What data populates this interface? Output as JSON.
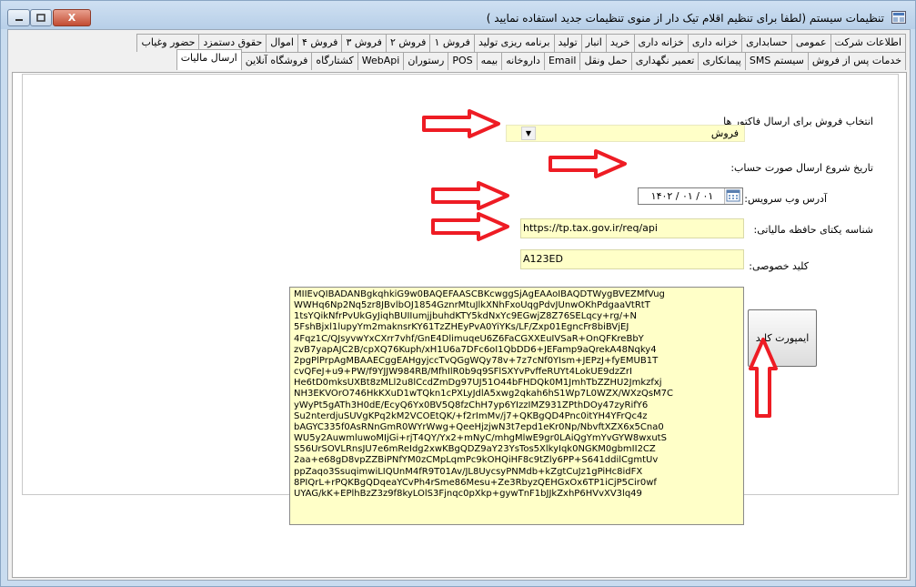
{
  "window": {
    "title": "تنظیمات سیستم (لطفا برای تنظیم اقلام تیک دار از منوی تنظیمات جدید استفاده نمایید )",
    "close_label": "X"
  },
  "tabs_row1": [
    "اطلاعات شرکت",
    "عمومی",
    "حسابداری",
    "خزانه داری",
    "خزانه داری",
    "خرید",
    "انبار",
    "تولید",
    "برنامه ریزی تولید",
    "فروش ۱",
    "فروش ۲",
    "فروش ۳",
    "فروش ۴",
    "اموال",
    "حقوق دستمزد",
    "حضور وغیاب"
  ],
  "tabs_row2": [
    "خدمات پس از فروش",
    "سیستم SMS",
    "پیمانکاری",
    "تعمیر نگهداری",
    "حمل ونقل",
    "Email",
    "داروخانه",
    "بیمه",
    "POS",
    "رستوران",
    "WebApi",
    "کشتارگاه",
    "فروشگاه آنلاین",
    "ارسال مالیات"
  ],
  "active_tab": "ارسال مالیات",
  "form": {
    "invoice_label": "انتخاب فروش برای ارسال فاکتور ها",
    "invoice_value": "فروش",
    "start_date_label": "تاریخ شروع ارسال صورت حساب:",
    "start_date_value": "۱۴۰۲ / ۰۱ / ۰۱",
    "service_label": "آدرس وب سرویس:",
    "service_value": "https://tp.tax.gov.ir/req/api",
    "memory_label": "شناسه یکتای حافظه مالیاتی:",
    "memory_value": "A123ED",
    "private_key_label": "کلید خصوصی:",
    "import_key_button": "ایمپورت کلید"
  },
  "private_key_lines": [
    "MIIEvQIBADANBgkqhkiG9w0BAQEFAASCBKcwggSjAgEAAoIBAQDTWygBVEZMfVug",
    "WWHq6Np2Nq5zr8JBvlbOJ1854GznrMtuJlkXNhFxoUqgPdvJUnwOKhPdgaaVtRtT",
    "1tsYQikNfrPvUkGyJiqhBUIIumjjbuhdKTY5kdNxYc9EGwjZ8Z76SELqcy+rg/+N",
    "5FshBjxl1lupyYm2maknsrKY61TzZHEyPvA0YiYKs/LF/Zxp01EgncFr8biBVjEJ",
    "4Fqz1C/QJsyvwYxCXrr7vhf/GnE4DlimuqeU6Z6FaCGXXEuIVSaR+OnQFKreBbY",
    "zvB7yapAJC2B/cpXQ76Kuph/xH1U6a7DFc6oI1QbDD6+JEFamp9aQrekA48Nqky4",
    "2pgPlPrpAgMBAAECggEAHgyjccTvQGgWQy78v+7z7cNf0YIsm+JEPzJ+fyEMUB1T",
    "cvQFeJ+u9+PW/f9YJJW984RB/MfhIlR0b9q9SFlSXYvPvffeRUYt4LokUE9dzZrI",
    "He6tD0mksUXBt8zMLl2u8lCcdZmDg97UJ51O44bFHDQk0M1JmhTbZZHU2Jmkzfxj",
    "NH3EKVOrO746HkKXuD1wTQkn1cPXLyJdlA5xwg2qkah6hS1Wp7L0WZX/WXzQsM7C",
    "yWyPt5gATh3H0dE/EcyQ6Yx0BV5Q8fzChH7yp6YIzzIMZ931ZPthDOy47zyRifY6",
    "Su2nterdjuSUVgKPq2kM2VCOEtQK/+f2rImMv/j7+QKBgQD4Pnc0itYH4YFrQc4z",
    "bAGYC335f0AsRNnGmR0WYrWwg+QeeHjzjwN3t7epd1eKr0Np/NbvftXZX6x5Cna0",
    "WU5y2AuwmluwoMIjGi+rjT4QY/Yx2+mNyC/mhgMlwE9gr0LAiQgYmYvGYW8wxutS",
    "S56UrSOVLRnsJU7e6mReIdg2xwKBgQDZ9aY23YsTos5XlkyIqk0NGKM0gbmII2CZ",
    "2aa+e68gD8vpZZBiPNfYM0zCMpLqmPc9kOHQiHF8c9tZly6PP+S641ddilCgmtUv",
    "ppZaqo3SsuqimwiLIQUnM4fR9T01Av/JL8UycsyPNMdb+kZgtCuJz1gPiHc8idFX",
    "8PIQrL+rPQKBgQDqeaYCvPh4rSme86Mesu+Ze3RbyzQEHGxOx6TP1iCjP5Cir0wf",
    "UYAG/kK+EPlhBzZ3z9f8kyLOlS3Fjnqc0pXkp+gywTnF1bJJkZxhP6HVvXV3lq49"
  ],
  "colors": {
    "window_frame": "#c9dcef",
    "field_yellow": "#ffffc8",
    "arrow_red": "#ee1c24"
  },
  "icons": [
    "app-icon",
    "minimize-icon",
    "maximize-icon",
    "close-icon",
    "dropdown-arrow-icon",
    "calendar-icon",
    "red-arrow-annotation"
  ]
}
